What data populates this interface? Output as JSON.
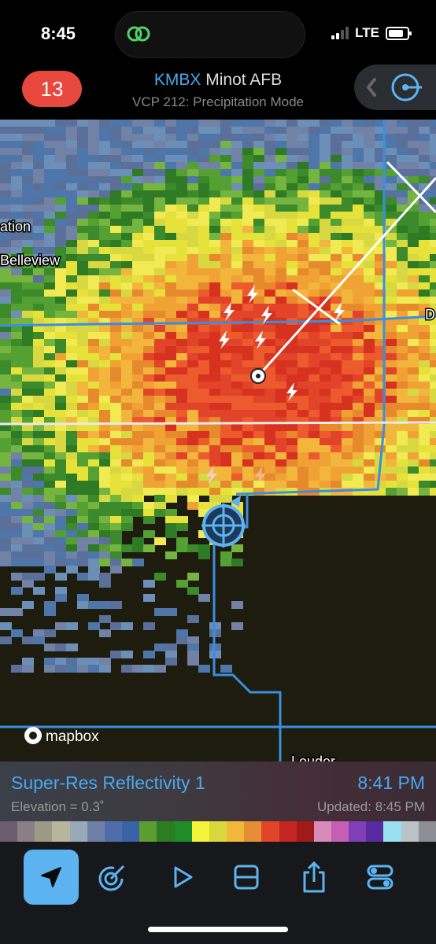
{
  "status_bar": {
    "time": "8:45",
    "network": "LTE"
  },
  "header": {
    "badge_count": "13",
    "station_code": "KMBX",
    "station_name": "Minot AFB",
    "vcp": "VCP 212: Precipitation Mode"
  },
  "map": {
    "labels": {
      "place_ation": "ation",
      "place_belleview": "Belleview",
      "place_d": "D",
      "place_louder": "Louder"
    },
    "attribution": "mapbox"
  },
  "info": {
    "product": "Super-Res Reflectivity 1",
    "elevation": "Elevation = 0.3˚",
    "scan_time": "8:41 PM",
    "updated": "Updated: 8:45 PM"
  },
  "colorbar": [
    "#6c5d6e",
    "#8a7f86",
    "#9c9a86",
    "#b7b59e",
    "#98aab8",
    "#6e7fa6",
    "#4f6daa",
    "#3a62a7",
    "#5b9d2e",
    "#2c7d21",
    "#1f8c2a",
    "#f4f43a",
    "#d9d83b",
    "#f3b83a",
    "#e58e36",
    "#e2442a",
    "#c4251e",
    "#a01a1a",
    "#d88aba",
    "#c45fb3",
    "#7f3fb8",
    "#5a2aa0",
    "#9ae0f0",
    "#b9c3c8",
    "#8c8f96"
  ],
  "toolbar": {
    "items": [
      "locate-icon",
      "radar-icon",
      "play-icon",
      "split-view-icon",
      "share-icon",
      "settings-toggle-icon"
    ]
  },
  "colors": {
    "accent": "#4aa8ee",
    "badge": "#e8483d",
    "map_bg": "#1d1c0e"
  }
}
